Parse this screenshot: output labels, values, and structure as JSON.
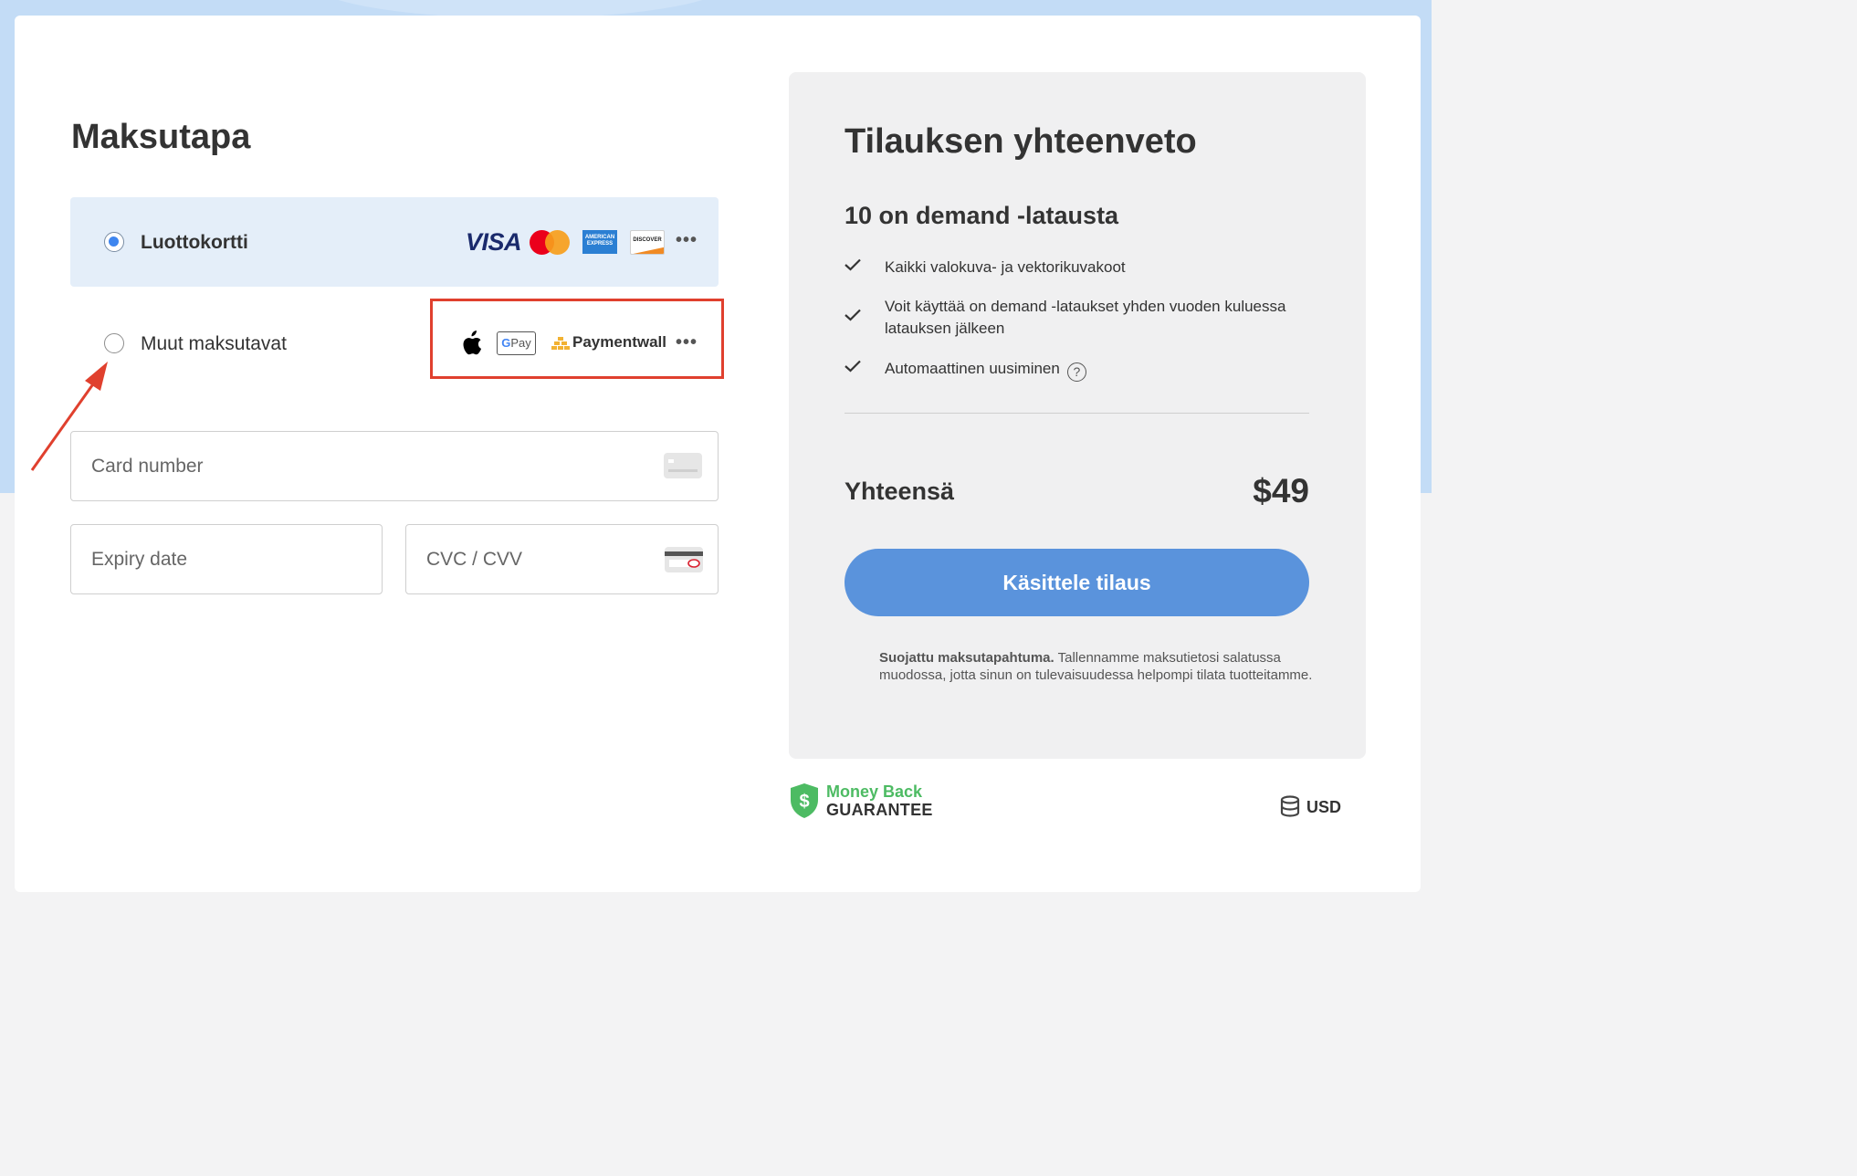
{
  "payment": {
    "title": "Maksutapa",
    "methods": [
      {
        "label": "Luottokortti",
        "selected": true,
        "brands": [
          "VISA",
          "mastercard",
          "AMERICAN EXPRESS",
          "DISCOVER"
        ],
        "more": "•••"
      },
      {
        "label": "Muut maksutavat",
        "selected": false,
        "brands": [
          "apple-pay",
          "G Pay",
          "Paymentwall"
        ],
        "more": "•••"
      }
    ],
    "visa_text": "VISA",
    "amex_text": "AMERICAN EXPRESS",
    "discover_text": "DISCOVER",
    "gpay_g": "G",
    "gpay_text": "Pay",
    "paymentwall_text": "Paymentwall",
    "fields": {
      "card_number_placeholder": "Card number",
      "expiry_placeholder": "Expiry date",
      "cvc_placeholder": "CVC / CVV"
    }
  },
  "summary": {
    "title": "Tilauksen yhteenveto",
    "plan": "10 on demand -latausta",
    "features": [
      "Kaikki valokuva- ja vektorikuvakoot",
      "Voit käyttää on demand -lataukset yhden vuoden kuluessa latauksen jälkeen",
      "Automaattinen uusiminen"
    ],
    "help_glyph": "?",
    "total_label": "Yhteensä",
    "total_price": "$49",
    "submit_label": "Käsittele tilaus",
    "secure_bold": "Suojattu maksutapahtuma.",
    "secure_text": " Tallennamme maksutietosi salatussa muodossa, jotta sinun on tulevaisuudessa helpompi tilata tuotteitamme."
  },
  "footer": {
    "guarantee_line1": "Money Back",
    "guarantee_line2": "GUARANTEE",
    "currency": "USD"
  },
  "colors": {
    "accent_button": "#5a93dc",
    "selected_bg": "#e4eef9",
    "highlight_annotation": "#e0402e",
    "guarantee_green": "#4dbb63"
  },
  "icons": [
    "apple-icon",
    "paymentwall-icon",
    "card-chip-icon",
    "card-cvc-icon",
    "check-icon",
    "help-icon",
    "shield-dollar-icon",
    "coins-icon",
    "annotation-arrow"
  ]
}
